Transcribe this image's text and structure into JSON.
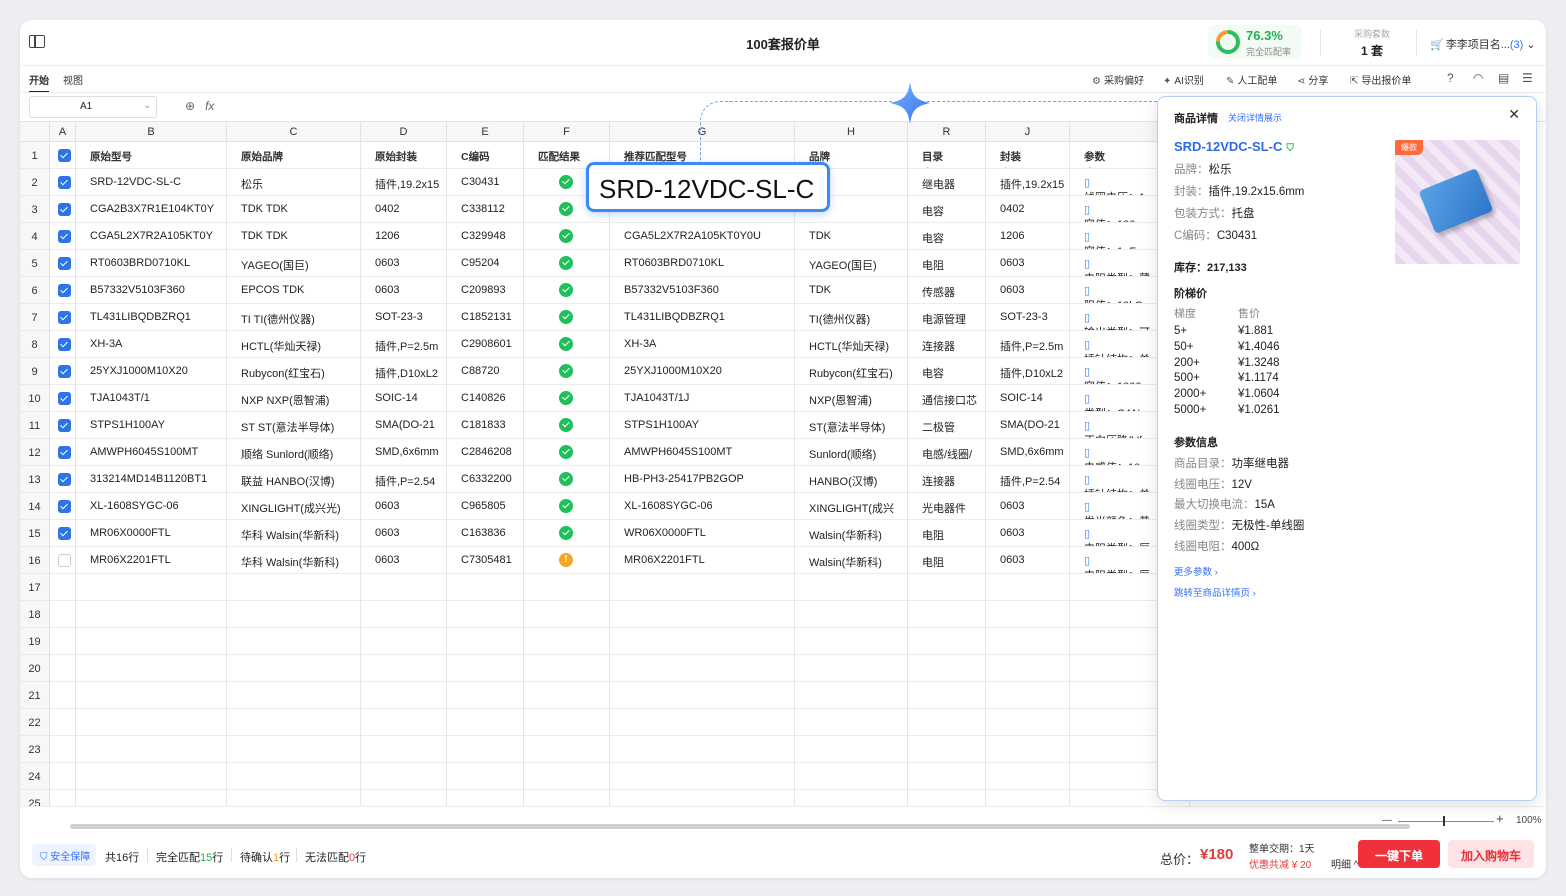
{
  "title": "100套报价单",
  "match_rate": {
    "value": "76.3%",
    "label": "完全匹配率"
  },
  "purchase_sets": {
    "label": "采购套数",
    "value": "1 套"
  },
  "project": {
    "name": "李李项目名...",
    "count": "(3)"
  },
  "menu": {
    "tabs": [
      "开始",
      "视图"
    ]
  },
  "toolbar": {
    "pref": "采购偏好",
    "ai": "AI识别",
    "manual": "人工配单",
    "share": "分享",
    "export": "导出报价单"
  },
  "formula": {
    "cell": "A1",
    "fx": "fx"
  },
  "columns": [
    "A",
    "B",
    "C",
    "D",
    "E",
    "F",
    "G",
    "H",
    "R",
    "J",
    ""
  ],
  "headers": [
    "原始型号",
    "原始品牌",
    "原始封装",
    "C编码",
    "匹配结果",
    "推荐匹配型号",
    "品牌",
    "目录",
    "封装",
    "参数"
  ],
  "rows": [
    {
      "n": "2",
      "checked": true,
      "status": "ok",
      "b": "SRD-12VDC-SL-C",
      "c": "松乐",
      "d": "插件,19.2x15",
      "e": "C30431",
      "g": "",
      "h": "",
      "r": "继电器",
      "j": "插件,19.2x15",
      "k": "线圈电压：1"
    },
    {
      "n": "3",
      "checked": true,
      "status": "ok",
      "b": "CGA2B3X7R1E104KT0Y",
      "c": "TDK TDK",
      "d": "0402",
      "e": "C338112",
      "g": "",
      "h": "",
      "r": "电容",
      "j": "0402",
      "k": "容值：100n"
    },
    {
      "n": "4",
      "checked": true,
      "status": "ok",
      "b": "CGA5L2X7R2A105KT0Y",
      "c": "TDK TDK",
      "d": "1206",
      "e": "C329948",
      "g": "CGA5L2X7R2A105KT0Y0U",
      "h": "TDK",
      "r": "电容",
      "j": "1206",
      "k": "容值：1uF"
    },
    {
      "n": "5",
      "checked": true,
      "status": "ok",
      "b": "RT0603BRD0710KL",
      "c": "YAGEO(国巨)",
      "d": "0603",
      "e": "C95204",
      "g": "RT0603BRD0710KL",
      "h": "YAGEO(国巨)",
      "r": "电阻",
      "j": "0603",
      "k": "电阻类型：薄"
    },
    {
      "n": "6",
      "checked": true,
      "status": "ok",
      "b": "B57332V5103F360",
      "c": "EPCOS TDK",
      "d": "0603",
      "e": "C209893",
      "g": "B57332V5103F360",
      "h": "TDK",
      "r": "传感器",
      "j": "0603",
      "k": "阻值：10kΩ"
    },
    {
      "n": "7",
      "checked": true,
      "status": "ok",
      "b": "TL431LIBQDBZRQ1",
      "c": "TI TI(德州仪器)",
      "d": "SOT-23-3",
      "e": "C1852131",
      "g": "TL431LIBQDBZRQ1",
      "h": "TI(德州仪器)",
      "r": "电源管理",
      "j": "SOT-23-3",
      "k": "输出类型：可"
    },
    {
      "n": "8",
      "checked": true,
      "status": "ok",
      "b": "XH-3A",
      "c": "HCTL(华灿天禄)",
      "d": "插件,P=2.5m",
      "e": "C2908601",
      "g": "XH-3A",
      "h": "HCTL(华灿天禄)",
      "r": "连接器",
      "j": "插件,P=2.5m",
      "k": "插针结构：单"
    },
    {
      "n": "9",
      "checked": true,
      "status": "ok",
      "b": "25YXJ1000M10X20",
      "c": "Rubycon(红宝石)",
      "d": "插件,D10xL2",
      "e": "C88720",
      "g": "25YXJ1000M10X20",
      "h": "Rubycon(红宝石)",
      "r": "电容",
      "j": "插件,D10xL2",
      "k": "容值：1000"
    },
    {
      "n": "10",
      "checked": true,
      "status": "ok",
      "b": "TJA1043T/1",
      "c": "NXP NXP(恩智浦)",
      "d": "SOIC-14",
      "e": "C140826",
      "g": "TJA1043T/1J",
      "h": "NXP(恩智浦)",
      "r": "通信接口芯",
      "j": "SOIC-14",
      "k": "类型：CAN"
    },
    {
      "n": "11",
      "checked": true,
      "status": "ok",
      "b": "STPS1H100AY",
      "c": "ST ST(意法半导体)",
      "d": "SMA(DO-21",
      "e": "C181833",
      "g": "STPS1H100AY",
      "h": "ST(意法半导体)",
      "r": "二极管",
      "j": "SMA(DO-21",
      "k": "正向压降(Vf"
    },
    {
      "n": "12",
      "checked": true,
      "status": "ok",
      "b": "AMWPH6045S100MT",
      "c": "顺络 Sunlord(顺络)",
      "d": "SMD,6x6mm",
      "e": "C2846208",
      "g": "AMWPH6045S100MT",
      "h": "Sunlord(顺络)",
      "r": "电感/线圈/",
      "j": "SMD,6x6mm",
      "k": "电感值：10"
    },
    {
      "n": "13",
      "checked": true,
      "status": "ok",
      "b": "313214MD14B1120BT1",
      "c": "联益 HANBO(汉博)",
      "d": "插件,P=2.54",
      "e": "C6332200",
      "g": "HB-PH3-25417PB2GOP",
      "h": "HANBO(汉博)",
      "r": "连接器",
      "j": "插件,P=2.54",
      "k": "插针结构：单"
    },
    {
      "n": "14",
      "checked": true,
      "status": "ok",
      "b": "XL-1608SYGC-06",
      "c": "XINGLIGHT(成兴光)",
      "d": "0603",
      "e": "C965805",
      "g": "XL-1608SYGC-06",
      "h": "XINGLIGHT(成兴",
      "r": "光电器件",
      "j": "0603",
      "k": "发光颜色：黄"
    },
    {
      "n": "15",
      "checked": true,
      "status": "ok",
      "b": "MR06X0000FTL",
      "c": "华科 Walsin(华新科)",
      "d": "0603",
      "e": "C163836",
      "g": "WR06X0000FTL",
      "h": "Walsin(华新科)",
      "r": "电阻",
      "j": "0603",
      "k": "电阻类型：厚"
    },
    {
      "n": "16",
      "checked": false,
      "status": "warn",
      "b": "MR06X2201FTL",
      "c": "华科 Walsin(华新科)",
      "d": "0603",
      "e": "C7305481",
      "g": "MR06X2201FTL",
      "h": "Walsin(华新科)",
      "r": "电阻",
      "j": "0603",
      "k": "电阻类型：厚"
    }
  ],
  "empty_rows": [
    "17",
    "18",
    "19",
    "20",
    "21",
    "22",
    "23",
    "24",
    "25"
  ],
  "tooltip": "SRD-12VDC-SL-C",
  "panel": {
    "title": "商品详情",
    "close_link": "关闭详情展示",
    "model": "SRD-12VDC-SL-C",
    "hot_badge": "爆款",
    "brand_k": "品牌：",
    "brand_v": "松乐",
    "pkg_k": "封装：",
    "pkg_v": "插件,19.2x15.6mm",
    "packing_k": "包装方式：",
    "packing_v": "托盘",
    "code_k": "C编码：",
    "code_v": "C30431",
    "stock": "库存：217,133",
    "tier_title": "阶梯价",
    "tier_hdr_qty": "梯度",
    "tier_hdr_price": "售价",
    "tiers": [
      {
        "q": "5+",
        "p": "¥1.881"
      },
      {
        "q": "50+",
        "p": "¥1.4046"
      },
      {
        "q": "200+",
        "p": "¥1.3248"
      },
      {
        "q": "500+",
        "p": "¥1.1174"
      },
      {
        "q": "2000+",
        "p": "¥1.0604"
      },
      {
        "q": "5000+",
        "p": "¥1.0261"
      }
    ],
    "param_title": "参数信息",
    "params": [
      {
        "k": "商品目录：",
        "v": "功率继电器"
      },
      {
        "k": "线圈电压：",
        "v": "12V"
      },
      {
        "k": "最大切换电流：",
        "v": "15A"
      },
      {
        "k": "线圈类型：",
        "v": "无极性-单线圈"
      },
      {
        "k": "线圈电阻：",
        "v": "400Ω"
      }
    ],
    "more": "更多参数",
    "goto": "跳转至商品详情页"
  },
  "zoom": {
    "minus": "—",
    "plus": "+",
    "level": "100%"
  },
  "footer": {
    "safe": "安全保障",
    "total_rows": "共16行",
    "full_match_pre": "完全匹配",
    "full_match_n": "15",
    "full_match_suf": "行",
    "pending_pre": "待确认",
    "pending_n": "1",
    "pending_suf": "行",
    "nomatch_pre": "无法匹配",
    "nomatch_n": "0",
    "nomatch_suf": "行",
    "total_label": "总价：",
    "total_value": "¥180",
    "lead_time": "整单交期：1天",
    "discount": "优惠共减 ¥ 20",
    "detail": "明细 ^",
    "order_btn": "一键下单",
    "cart_btn": "加入购物车"
  }
}
